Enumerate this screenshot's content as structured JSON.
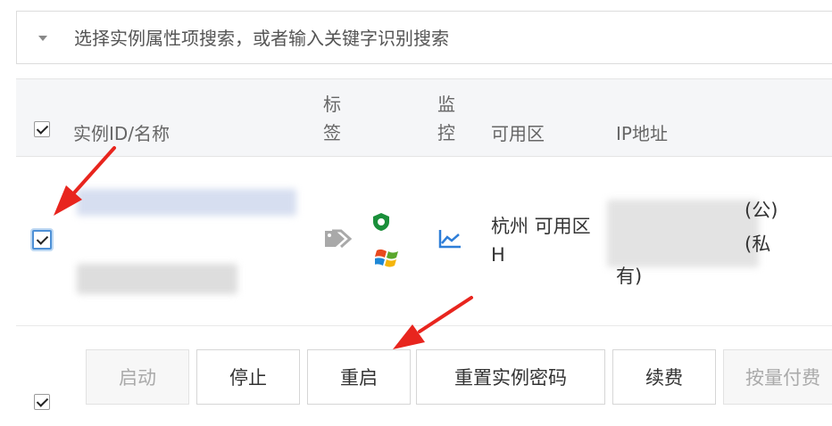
{
  "search": {
    "placeholder": "选择实例属性项搜索，或者输入关键字识别搜索"
  },
  "table": {
    "headers": {
      "instance": "实例ID/名称",
      "tags": "标签",
      "monitor": "监控",
      "zone": "可用区",
      "ip": "IP地址"
    },
    "rows": [
      {
        "zone": "杭州 可用区H",
        "ip_public_suffix": "(公)",
        "ip_private_suffix_1": "(私",
        "ip_private_suffix_2": "有)",
        "icons": [
          "tag-icon",
          "shield-icon",
          "windows-icon",
          "monitor-chart-icon"
        ]
      }
    ]
  },
  "actions": {
    "start": "启动",
    "stop": "停止",
    "restart": "重启",
    "reset_password": "重置实例密码",
    "renew": "续费",
    "pay_as_you_go": "按量付费"
  },
  "colors": {
    "accent_blue": "#4d90d6",
    "arrow_red": "#e8251e",
    "header_bg": "#f5f6f8",
    "shield_green": "#1a8f3a"
  }
}
